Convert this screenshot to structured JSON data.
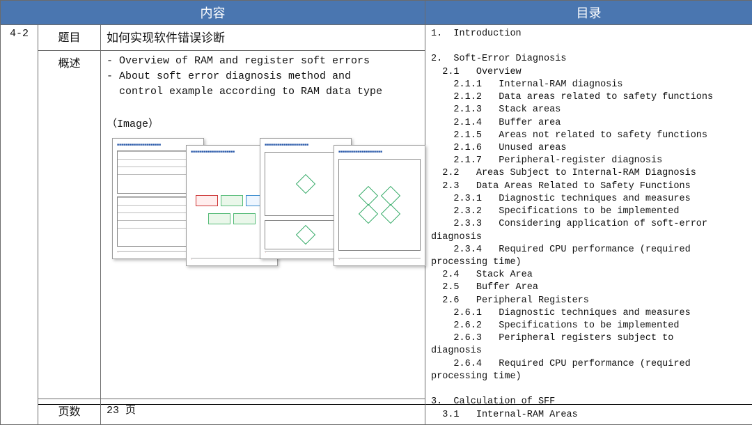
{
  "header": {
    "content": "内容",
    "toc": "目录"
  },
  "row": {
    "id": "4-2",
    "title_label": "题目",
    "title": "如何实现软件错误诊断",
    "summary_label": "概述",
    "summary_bullets": [
      "- Overview of RAM and register soft errors",
      "- About soft error diagnosis method and",
      "  control example according to RAM data type"
    ],
    "image_label": "（Image）",
    "pages_label": "页数",
    "pages_value": "23 页"
  },
  "toc_lines": [
    "1.  Introduction",
    "",
    "2.  Soft-Error Diagnosis",
    "  2.1   Overview",
    "    2.1.1   Internal-RAM diagnosis",
    "    2.1.2   Data areas related to safety functions",
    "    2.1.3   Stack areas",
    "    2.1.4   Buffer area",
    "    2.1.5   Areas not related to safety functions",
    "    2.1.6   Unused areas",
    "    2.1.7   Peripheral-register diagnosis",
    "  2.2   Areas Subject to Internal-RAM Diagnosis",
    "  2.3   Data Areas Related to Safety Functions",
    "    2.3.1   Diagnostic techniques and measures",
    "    2.3.2   Specifications to be implemented",
    "    2.3.3   Considering application of soft-error",
    "diagnosis",
    "    2.3.4   Required CPU performance (required",
    "processing time)",
    "  2.4   Stack Area",
    "  2.5   Buffer Area",
    "  2.6   Peripheral Registers",
    "    2.6.1   Diagnostic techniques and measures",
    "    2.6.2   Specifications to be implemented",
    "    2.6.3   Peripheral registers subject to",
    "diagnosis",
    "    2.6.4   Required CPU performance (required",
    "processing time)",
    "",
    "3.  Calculation of SFF",
    "  3.1   Internal-RAM Areas"
  ]
}
